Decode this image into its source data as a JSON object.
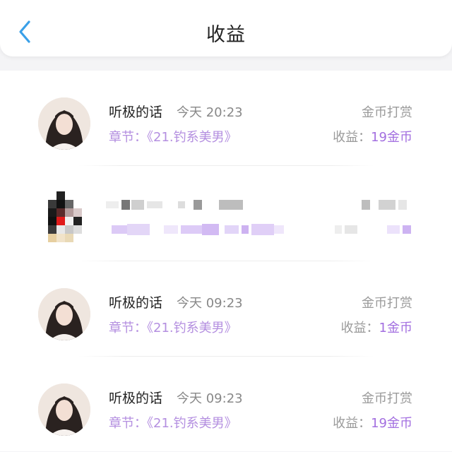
{
  "header": {
    "title": "收益"
  },
  "rows": [
    {
      "name": "听极的话",
      "time": "今天 20:23",
      "type": "金币打赏",
      "chapter_label": "章节：",
      "chapter": "《21.钓系美男》",
      "earn_label": "收益：",
      "earn_value": "19金币"
    },
    {
      "name": "",
      "time": "",
      "type": "",
      "chapter_label": "",
      "chapter": "",
      "earn_label": "",
      "earn_value": ""
    },
    {
      "name": "听极的话",
      "time": "今天 09:23",
      "type": "金币打赏",
      "chapter_label": "章节：",
      "chapter": "《21.钓系美男》",
      "earn_label": "收益：",
      "earn_value": "1金币"
    },
    {
      "name": "听极的话",
      "time": "今天 09:23",
      "type": "金币打赏",
      "chapter_label": "章节：",
      "chapter": "《21.钓系美男》",
      "earn_label": "收益：",
      "earn_value": "19金币"
    }
  ],
  "colors": {
    "accent_purple": "#a36fe0",
    "back_blue": "#3aa0e8"
  },
  "icons": {
    "back": "chevron-left-icon",
    "avatar": "user-avatar"
  }
}
